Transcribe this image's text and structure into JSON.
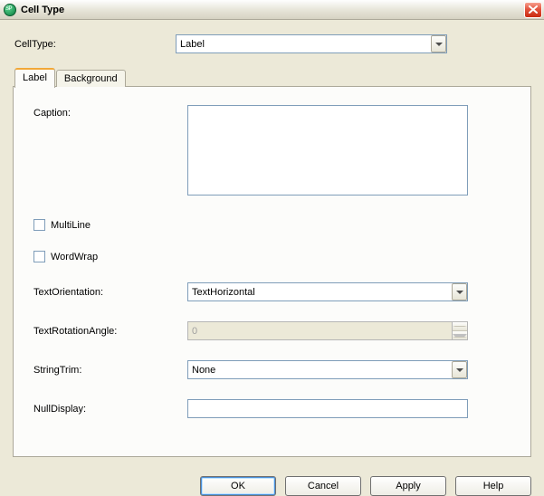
{
  "window": {
    "title": "Cell Type"
  },
  "top": {
    "celltype_label": "CellType:",
    "celltype_value": "Label"
  },
  "tabs": {
    "label": "Label",
    "background": "Background"
  },
  "form": {
    "caption_label": "Caption:",
    "caption_value": "",
    "multiline_label": "MultiLine",
    "multiline_checked": false,
    "wordwrap_label": "WordWrap",
    "wordwrap_checked": false,
    "textorientation_label": "TextOrientation:",
    "textorientation_value": "TextHorizontal",
    "textrotationangle_label": "TextRotationAngle:",
    "textrotationangle_value": "0",
    "stringtrim_label": "StringTrim:",
    "stringtrim_value": "None",
    "nulldisplay_label": "NullDisplay:",
    "nulldisplay_value": ""
  },
  "buttons": {
    "ok": "OK",
    "cancel": "Cancel",
    "apply": "Apply",
    "help": "Help"
  }
}
